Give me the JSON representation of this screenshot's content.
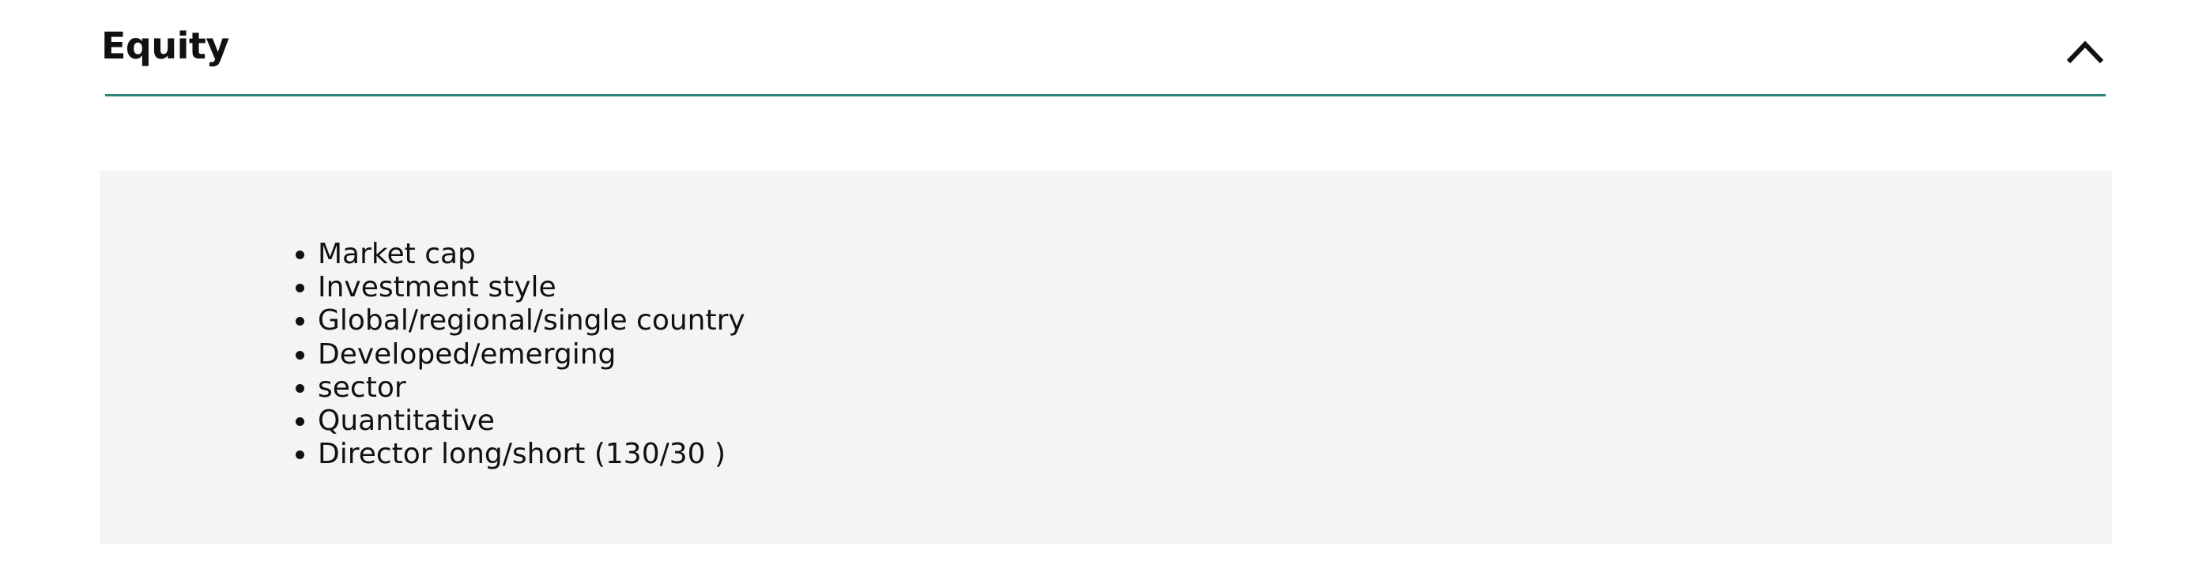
{
  "accordion": {
    "title": "Equity",
    "toggle_icon": "chevron-up-icon",
    "expanded": true,
    "accent_color": "#2a8578",
    "panel_background": "#f4f4f4",
    "items": [
      {
        "label": "Market cap"
      },
      {
        "label": "Investment style"
      },
      {
        "label": "Global/regional/single country"
      },
      {
        "label": "Developed/emerging"
      },
      {
        "label": "sector"
      },
      {
        "label": "Quantitative"
      },
      {
        "label": "Director long/short (130/30 )"
      }
    ]
  }
}
